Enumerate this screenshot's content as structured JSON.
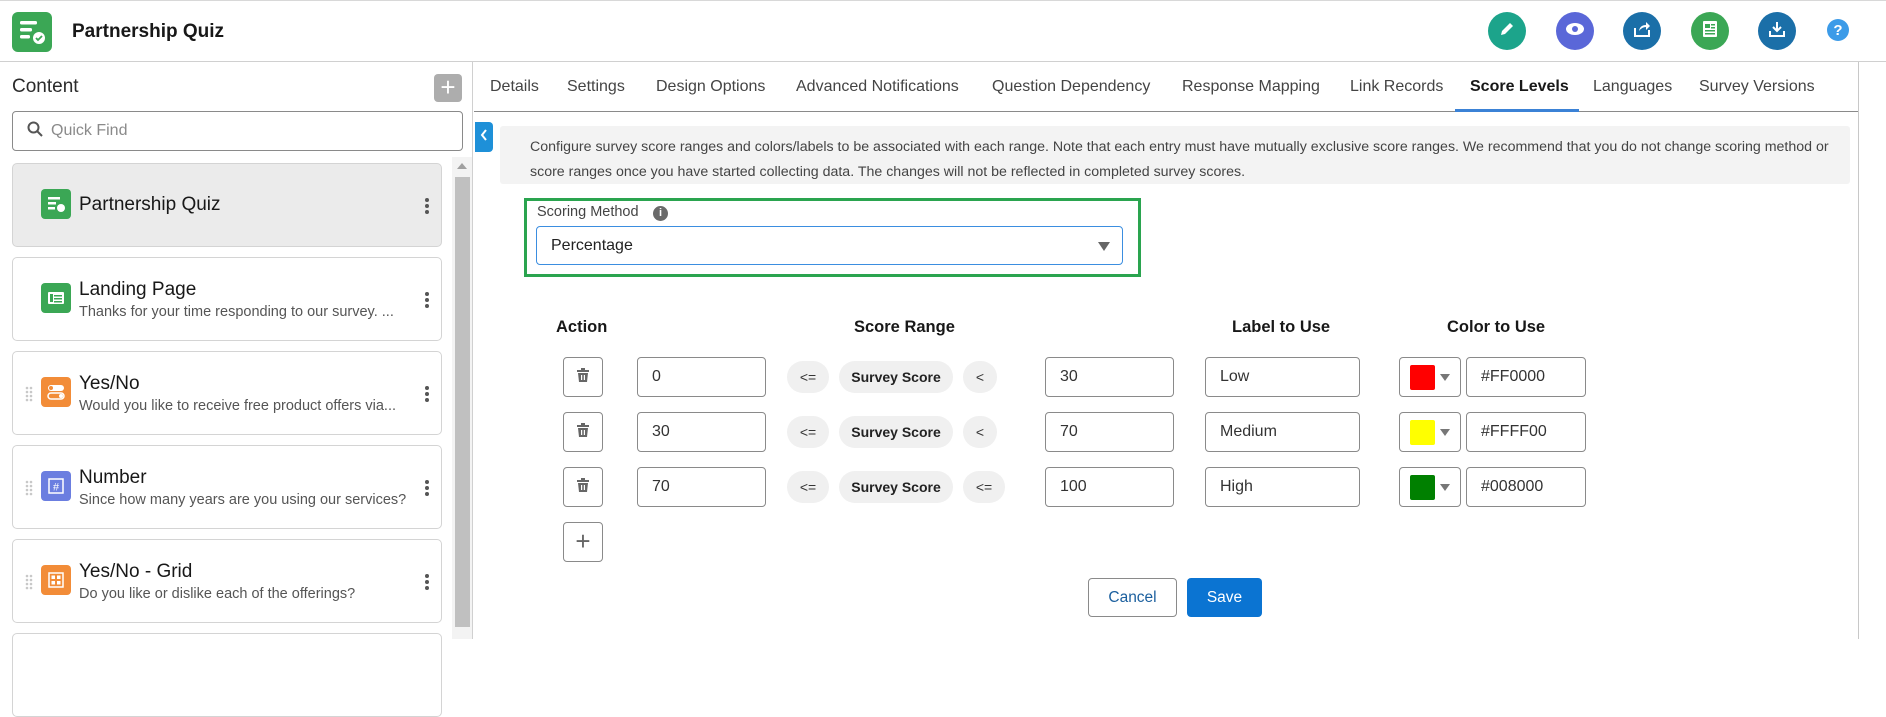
{
  "header": {
    "title": "Partnership Quiz",
    "actions": [
      {
        "name": "edit",
        "icon": "pencil-icon",
        "color": "#1ca48b"
      },
      {
        "name": "preview",
        "icon": "eye-icon",
        "color": "#5a67d8"
      },
      {
        "name": "share",
        "icon": "share-icon",
        "color": "#1b6fa8"
      },
      {
        "name": "report",
        "icon": "report-icon",
        "color": "#3ba755"
      },
      {
        "name": "download",
        "icon": "download-icon",
        "color": "#1b6fa8"
      },
      {
        "name": "help",
        "icon": "help-icon",
        "label": "?",
        "color": "#3c9be8"
      }
    ]
  },
  "sidebar": {
    "title": "Content",
    "add_label": "+",
    "search_placeholder": "Quick Find",
    "items": [
      {
        "title": "Partnership Quiz",
        "subtitle": "",
        "icon": "survey-icon",
        "color": "#3ba755",
        "active": true
      },
      {
        "title": "Landing Page",
        "subtitle": "Thanks for your time responding to our survey. ...",
        "icon": "landing-page-icon",
        "color": "#3ba755"
      },
      {
        "title": "Yes/No",
        "subtitle": "Would you like to receive free product offers via...",
        "icon": "toggle-icon",
        "color": "#f28c38"
      },
      {
        "title": "Number",
        "subtitle": "Since how many years are you using our services?",
        "icon": "number-icon",
        "color": "#6b7ee0"
      },
      {
        "title": "Yes/No - Grid",
        "subtitle": "Do you like or dislike each of the offerings?",
        "icon": "grid-icon",
        "color": "#f28c38"
      }
    ]
  },
  "tabs": [
    {
      "label": "Details"
    },
    {
      "label": "Settings"
    },
    {
      "label": "Design Options"
    },
    {
      "label": "Advanced Notifications"
    },
    {
      "label": "Question Dependency"
    },
    {
      "label": "Response Mapping"
    },
    {
      "label": "Link Records"
    },
    {
      "label": "Score Levels",
      "active": true
    },
    {
      "label": "Languages"
    },
    {
      "label": "Survey Versions"
    }
  ],
  "info_text": "Configure survey score ranges and colors/labels to be associated with each range. Note that each entry must have mutually exclusive score ranges. We recommend that you do not change scoring method or score ranges once you have started collecting data. The changes will not be reflected in completed survey scores.",
  "scoring": {
    "label": "Scoring Method",
    "info_glyph": "i",
    "value": "Percentage"
  },
  "table": {
    "headers": {
      "action": "Action",
      "score_range": "Score Range",
      "label": "Label to Use",
      "color": "Color to Use"
    },
    "survey_score_label": "Survey Score",
    "rows": [
      {
        "min": "0",
        "op_left": "<=",
        "op_right": "<",
        "max": "30",
        "label": "Low",
        "color": "#FF0000"
      },
      {
        "min": "30",
        "op_left": "<=",
        "op_right": "<",
        "max": "70",
        "label": "Medium",
        "color": "#FFFF00"
      },
      {
        "min": "70",
        "op_left": "<=",
        "op_right": "<=",
        "max": "100",
        "label": "High",
        "color": "#008000"
      }
    ]
  },
  "buttons": {
    "add": "+",
    "cancel": "Cancel",
    "save": "Save"
  }
}
